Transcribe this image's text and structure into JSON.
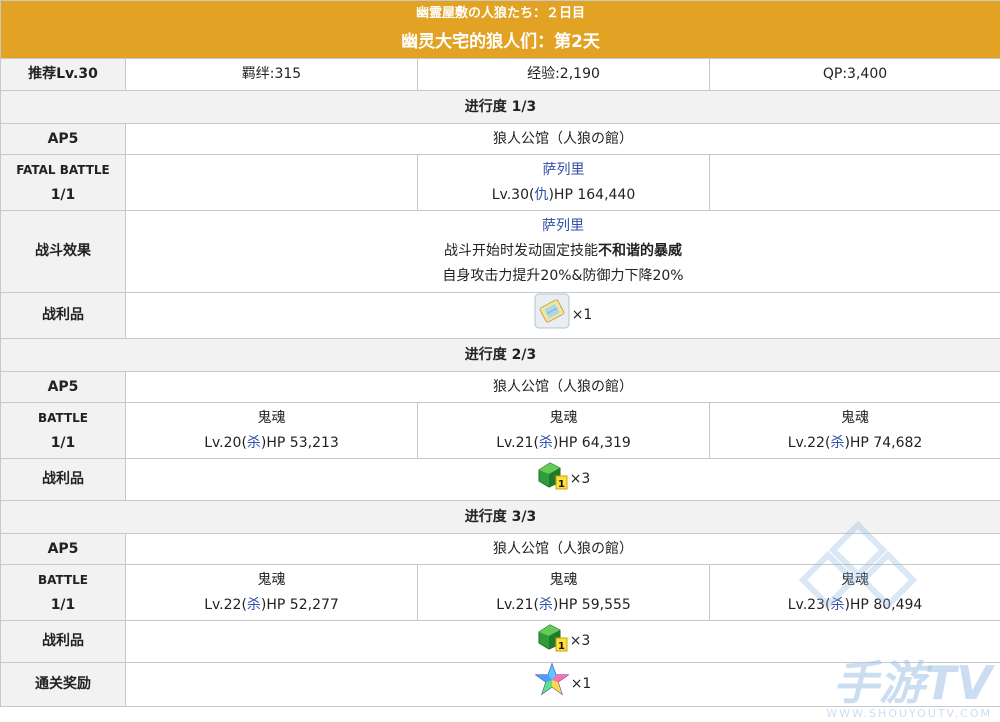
{
  "header": {
    "title_jp": "幽霊屋敷の人狼たち：２日目",
    "title_cn": "幽灵大宅的狼人们：第2天"
  },
  "summary": {
    "recommend": "推荐Lv.30",
    "bond": "羁绊:315",
    "exp": "经验:2,190",
    "qp": "QP:3,400"
  },
  "sections": [
    {
      "progress": "进行度 1/3",
      "ap": "AP5",
      "location": "狼人公馆（人狼の館）",
      "battle_label_line1": "FATAL BATTLE",
      "battle_label_line2": "1/1",
      "enemies": [
        {
          "name": "",
          "level": "",
          "cls": "",
          "hp": ""
        },
        {
          "name": "萨列里",
          "level": "Lv.30(",
          "cls": "仇",
          "hp": ")HP 164,440"
        },
        {
          "name": "",
          "level": "",
          "cls": "",
          "hp": ""
        }
      ],
      "effect_label": "战斗效果",
      "effect_name": "萨列里",
      "effect_line1_pre": "战斗开始时发动固定技能",
      "effect_line1_bold": "不和谐的暴威",
      "effect_line2": "自身攻击力提升20%&防御力下降20%",
      "loot_label": "战利品",
      "loot_icon": "ticket-icon",
      "loot_count": "×1"
    },
    {
      "progress": "进行度 2/3",
      "ap": "AP5",
      "location": "狼人公馆（人狼の館）",
      "battle_label_line1": "BATTLE",
      "battle_label_line2": "1/1",
      "enemies": [
        {
          "name": "鬼魂",
          "level": "Lv.20(",
          "cls": "杀",
          "hp": ")HP 53,213"
        },
        {
          "name": "鬼魂",
          "level": "Lv.21(",
          "cls": "杀",
          "hp": ")HP 64,319"
        },
        {
          "name": "鬼魂",
          "level": "Lv.22(",
          "cls": "杀",
          "hp": ")HP 74,682"
        }
      ],
      "loot_label": "战利品",
      "loot_icon": "green-gem-icon",
      "loot_badge": "1",
      "loot_count": "×3"
    },
    {
      "progress": "进行度 3/3",
      "ap": "AP5",
      "location": "狼人公馆（人狼の館）",
      "battle_label_line1": "BATTLE",
      "battle_label_line2": "1/1",
      "enemies": [
        {
          "name": "鬼魂",
          "level": "Lv.22(",
          "cls": "杀",
          "hp": ")HP 52,277"
        },
        {
          "name": "鬼魂",
          "level": "Lv.21(",
          "cls": "杀",
          "hp": ")HP 59,555"
        },
        {
          "name": "鬼魂",
          "level": "Lv.23(",
          "cls": "杀",
          "hp": ")HP 80,494"
        }
      ],
      "loot_label": "战利品",
      "loot_icon": "green-gem-icon",
      "loot_badge": "1",
      "loot_count": "×3",
      "reward_label": "通关奖励",
      "reward_icon": "saint-quartz-icon",
      "reward_count": "×1"
    }
  ],
  "watermark": {
    "brand": "手游TV",
    "sub": "WWW.SHOUYOUTV.COM"
  },
  "colors": {
    "header_bg": "#e2a324",
    "label_bg": "#f2f2f2",
    "link_blue": "#2f4fa8",
    "border": "#c8c8c8"
  }
}
